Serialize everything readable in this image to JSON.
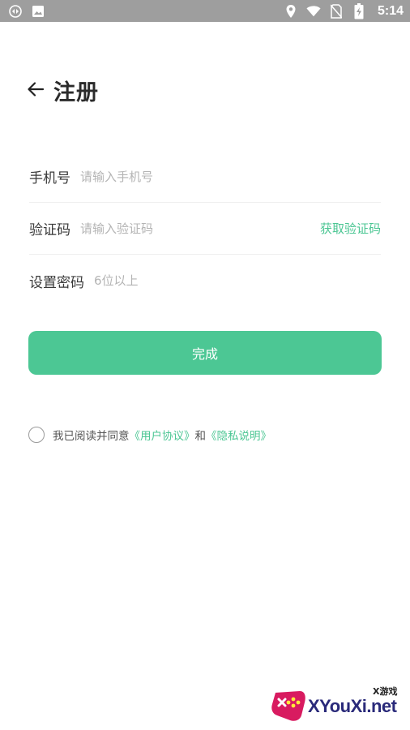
{
  "status_bar": {
    "time": "5:14",
    "left_icons": [
      "sync-icon",
      "image-icon"
    ],
    "right_icons": [
      "location-icon",
      "wifi-icon",
      "no-sim-icon",
      "battery-charging-icon"
    ]
  },
  "header": {
    "back_icon": "arrow-left-icon",
    "title": "注册"
  },
  "form": {
    "phone": {
      "label": "手机号",
      "placeholder": "请输入手机号",
      "value": ""
    },
    "code": {
      "label": "验证码",
      "placeholder": "请输入验证码",
      "value": "",
      "get_code_label": "获取验证码"
    },
    "password": {
      "label": "设置密码",
      "placeholder": "6位以上",
      "value": ""
    }
  },
  "submit_label": "完成",
  "agreement": {
    "checked": false,
    "prefix": "我已阅读并同意",
    "user_agreement": "《用户协议》",
    "and": "和",
    "privacy": "《隐私说明》"
  },
  "watermark": {
    "small": "X游戏",
    "text": "XYouXi.net"
  },
  "colors": {
    "accent": "#4cc794",
    "status_bar": "#9e9e9e",
    "title": "#2b2b2b",
    "placeholder": "#b4b4b4"
  }
}
